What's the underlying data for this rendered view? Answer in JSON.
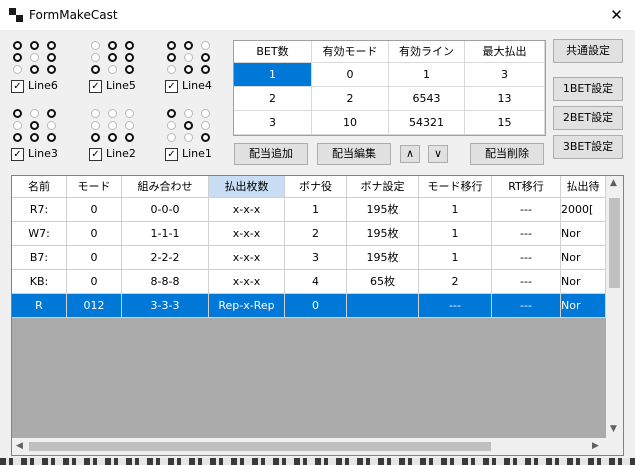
{
  "window": {
    "title": "FormMakeCast",
    "close_glyph": "✕"
  },
  "reels": [
    {
      "line_label": "Line6",
      "checked": true,
      "pattern": [
        "R",
        "R",
        "R",
        "R",
        "F",
        "R",
        "F",
        "R",
        "R"
      ]
    },
    {
      "line_label": "Line5",
      "checked": true,
      "pattern": [
        "F",
        "R",
        "R",
        "F",
        "R",
        "R",
        "R",
        "F",
        "R"
      ]
    },
    {
      "line_label": "Line4",
      "checked": true,
      "pattern": [
        "R",
        "R",
        "F",
        "R",
        "F",
        "R",
        "F",
        "R",
        "R"
      ]
    },
    {
      "line_label": "Line3",
      "checked": true,
      "pattern": [
        "R",
        "F",
        "R",
        "F",
        "R",
        "F",
        "R",
        "R",
        "R"
      ]
    },
    {
      "line_label": "Line2",
      "checked": true,
      "pattern": [
        "F",
        "F",
        "F",
        "F",
        "F",
        "F",
        "R",
        "R",
        "R"
      ]
    },
    {
      "line_label": "Line1",
      "checked": true,
      "pattern": [
        "R",
        "F",
        "F",
        "F",
        "R",
        "F",
        "F",
        "F",
        "R"
      ]
    }
  ],
  "bet_table": {
    "headers": [
      "BET数",
      "有効モード",
      "有効ライン",
      "最大払出"
    ],
    "rows": [
      [
        "1",
        "0",
        "1",
        "3"
      ],
      [
        "2",
        "2",
        "6543",
        "13"
      ],
      [
        "3",
        "10",
        "54321",
        "15"
      ]
    ]
  },
  "buttons": {
    "common_settings": "共通設定",
    "bet1_settings": "1BET設定",
    "bet2_settings": "2BET設定",
    "bet3_settings": "3BET設定",
    "add_payout": "配当追加",
    "edit_payout": "配当編集",
    "move_up": "∧",
    "move_down": "∨",
    "delete_payout": "配当削除"
  },
  "payout_grid": {
    "columns": [
      "名前",
      "モード",
      "組み合わせ",
      "払出枚数",
      "ボナ役",
      "ボナ設定",
      "モード移行",
      "RT移行",
      "払出待"
    ],
    "highlight_column": 3,
    "selected_row": 4,
    "rows": [
      [
        "R7:",
        "0",
        "0-0-0",
        "x-x-x",
        "1",
        "195枚",
        "1",
        "---",
        "2000["
      ],
      [
        "W7:",
        "0",
        "1-1-1",
        "x-x-x",
        "2",
        "195枚",
        "1",
        "---",
        "Nor"
      ],
      [
        "B7:",
        "0",
        "2-2-2",
        "x-x-x",
        "3",
        "195枚",
        "1",
        "---",
        "Nor"
      ],
      [
        "KB:",
        "0",
        "8-8-8",
        "x-x-x",
        "4",
        "65枚",
        "2",
        "---",
        "Nor"
      ],
      [
        "R",
        "012",
        "3-3-3",
        "Rep-x-Rep",
        "0",
        "",
        "---",
        "---",
        "Nor"
      ]
    ]
  },
  "colors": {
    "selection": "#0078d7",
    "header_highlight": "#c9def5",
    "grid_background": "#ababab"
  }
}
